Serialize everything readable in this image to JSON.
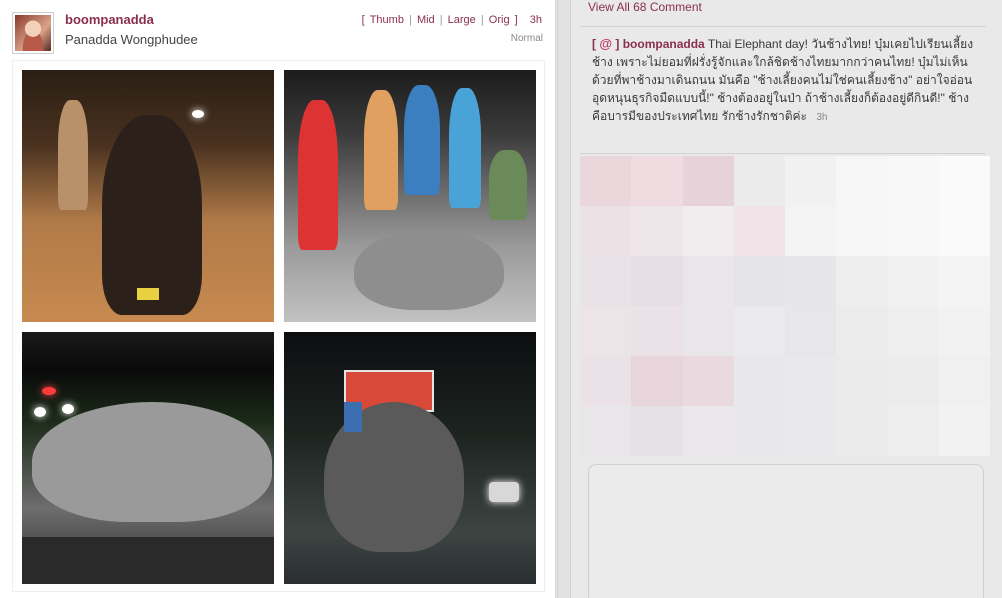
{
  "post": {
    "username": "boompanadda",
    "full_name": "Panadda Wongphudee",
    "size_links": {
      "open": "[",
      "thumb": "Thumb",
      "mid": "Mid",
      "large": "Large",
      "orig": "Orig",
      "close": "]",
      "sep": "|"
    },
    "time": "3h",
    "filter": "Normal"
  },
  "comments": {
    "view_all": "View All 68 Comment",
    "item": {
      "open_bracket": "[",
      "at": "@",
      "close_bracket": "]",
      "username": "boompanadda",
      "text": "Thai Elephant day! วันช้างไทย! บุ๋มเคยไปเรียนเลี้ยงช้าง เพราะไม่ยอมที่ฝรั่งรู้จักและใกล้ชิดช้างไทยมากกว่าคนไทย! บุ๋มไม่เห็นด้วยที่พาช้างมาเดินถนน มันคือ \"ช้างเลี้ยงคนไม่ใช่คนเลี้ยงช้าง\" อย่าใจอ่อนอุดหนุนธุรกิจมืดแบบนี้!\" ช้างต้องอยู่ในป่า ถ้าช้างเลี้ยงก็ต้องอยู่ดีกินดี!\" ช้างคือบารมีของประเทศไทย รักช้างรักชาติค่ะ",
      "time": "3h"
    }
  },
  "colors": {
    "accent": "#8a2f4e",
    "at_icon": "#c03a6a"
  },
  "icons": {
    "avatar": "avatar",
    "mention": "at-icon"
  }
}
